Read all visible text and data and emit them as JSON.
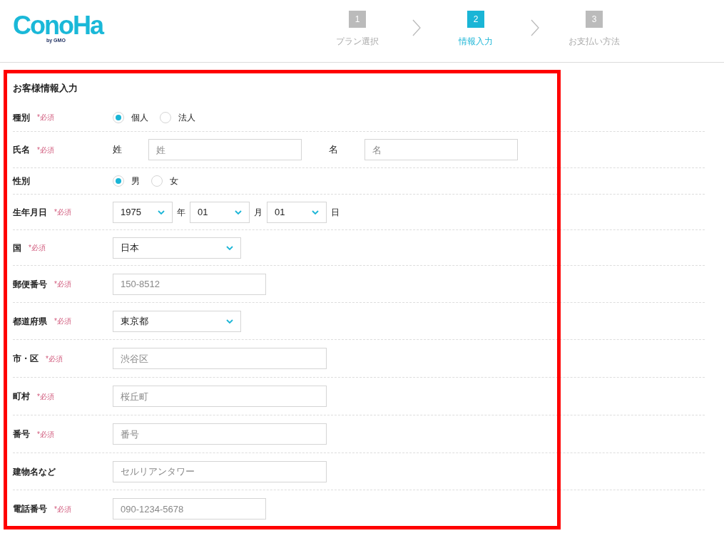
{
  "logo": {
    "text": "ConoHa",
    "sub": "by GMO"
  },
  "steps": [
    {
      "number": "1",
      "label": "プラン選択",
      "selected": false
    },
    {
      "number": "2",
      "label": "情報入力",
      "selected": true
    },
    {
      "number": "3",
      "label": "お支払い方法",
      "selected": false
    }
  ],
  "form": {
    "title": "お客様情報入力",
    "rows": [
      {
        "label": "種別",
        "required": "*必須",
        "kind": "radio",
        "options": [
          {
            "label": "個人",
            "selected": true
          },
          {
            "label": "法人",
            "selected": false
          }
        ]
      },
      {
        "label": "氏名",
        "required": "*必須",
        "kind": "name",
        "parts": [
          {
            "label": "姓",
            "placeholder": "姓"
          },
          {
            "label": "名",
            "placeholder": "名"
          }
        ]
      },
      {
        "label": "性別",
        "kind": "radio",
        "options": [
          {
            "label": "男",
            "selected": true
          },
          {
            "label": "女",
            "selected": false
          }
        ]
      },
      {
        "label": "生年月日",
        "required": "*必須",
        "kind": "date",
        "parts": [
          {
            "value": "1975",
            "unit": "年"
          },
          {
            "value": "01",
            "unit": "月"
          },
          {
            "value": "01",
            "unit": "日"
          }
        ]
      },
      {
        "label": "国",
        "required": "*必須",
        "kind": "select",
        "value": "日本"
      },
      {
        "label": "郵便番号",
        "required": "*必須",
        "kind": "short_text",
        "placeholder": "150-8512"
      },
      {
        "label": "都道府県",
        "required": "*必須",
        "kind": "select",
        "value": "東京都"
      },
      {
        "label": "市・区",
        "required": "*必須",
        "kind": "long_text",
        "placeholder": "渋谷区"
      },
      {
        "label": "町村",
        "required": "*必須",
        "kind": "long_text",
        "placeholder": "桜丘町"
      },
      {
        "label": "番号",
        "required": "*必須",
        "kind": "long_text",
        "placeholder": "番号"
      },
      {
        "label": "建物名など",
        "kind": "long_text",
        "placeholder": "セルリアンタワー"
      },
      {
        "label": "電話番号",
        "required": "*必須",
        "kind": "short_text",
        "placeholder": "090-1234-5678"
      }
    ]
  }
}
